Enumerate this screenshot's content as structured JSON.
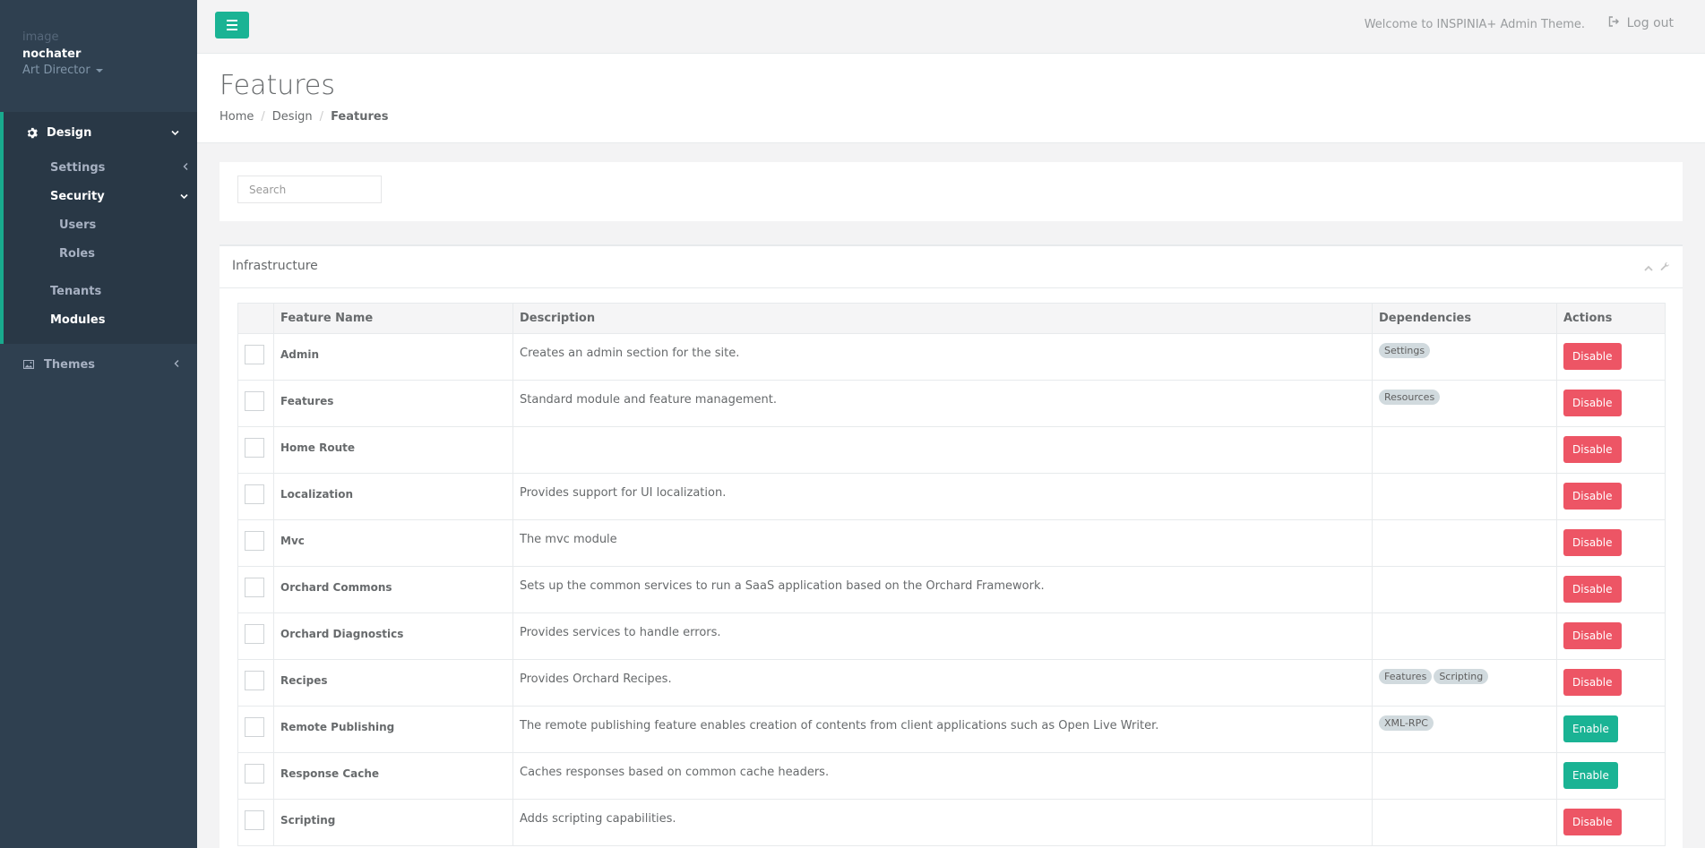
{
  "sidebar": {
    "profile": {
      "image_alt": "image",
      "name": "nochater",
      "role": "Art Director"
    },
    "design": {
      "label": "Design"
    },
    "settings": {
      "label": "Settings"
    },
    "security": {
      "label": "Security"
    },
    "users": {
      "label": "Users"
    },
    "roles": {
      "label": "Roles"
    },
    "tenants": {
      "label": "Tenants"
    },
    "modules": {
      "label": "Modules"
    },
    "themes": {
      "label": "Themes"
    }
  },
  "topbar": {
    "welcome": "Welcome to INSPINIA+ Admin Theme.",
    "logout": "Log out"
  },
  "page": {
    "title": "Features",
    "breadcrumb": [
      "Home",
      "Design",
      "Features"
    ]
  },
  "search": {
    "placeholder": "Search",
    "value": ""
  },
  "ibox": {
    "title": "Infrastructure"
  },
  "table": {
    "headers": [
      "",
      "Feature Name",
      "Description",
      "Dependencies",
      "Actions"
    ],
    "rows": [
      {
        "name": "Admin",
        "description": "Creates an admin section for the site.",
        "dependencies": [
          "Settings"
        ],
        "action": "Disable"
      },
      {
        "name": "Features",
        "description": "Standard module and feature management.",
        "dependencies": [
          "Resources"
        ],
        "action": "Disable"
      },
      {
        "name": "Home Route",
        "description": "",
        "dependencies": [],
        "action": "Disable"
      },
      {
        "name": "Localization",
        "description": "Provides support for UI localization.",
        "dependencies": [],
        "action": "Disable"
      },
      {
        "name": "Mvc",
        "description": "The mvc module",
        "dependencies": [],
        "action": "Disable"
      },
      {
        "name": "Orchard Commons",
        "description": "Sets up the common services to run a SaaS application based on the Orchard Framework.",
        "dependencies": [],
        "action": "Disable"
      },
      {
        "name": "Orchard Diagnostics",
        "description": "Provides services to handle errors.",
        "dependencies": [],
        "action": "Disable"
      },
      {
        "name": "Recipes",
        "description": "Provides Orchard Recipes.",
        "dependencies": [
          "Features",
          "Scripting"
        ],
        "action": "Disable"
      },
      {
        "name": "Remote Publishing",
        "description": "The remote publishing feature enables creation of contents from client applications such as Open Live Writer.",
        "dependencies": [
          "XML-RPC"
        ],
        "action": "Enable"
      },
      {
        "name": "Response Cache",
        "description": "Caches responses based on common cache headers.",
        "dependencies": [],
        "action": "Enable"
      },
      {
        "name": "Scripting",
        "description": "Adds scripting capabilities.",
        "dependencies": [],
        "action": "Disable"
      }
    ]
  },
  "colors": {
    "sidebar_bg": "#2f4050",
    "accent": "#1ab394",
    "danger": "#ed5565"
  }
}
